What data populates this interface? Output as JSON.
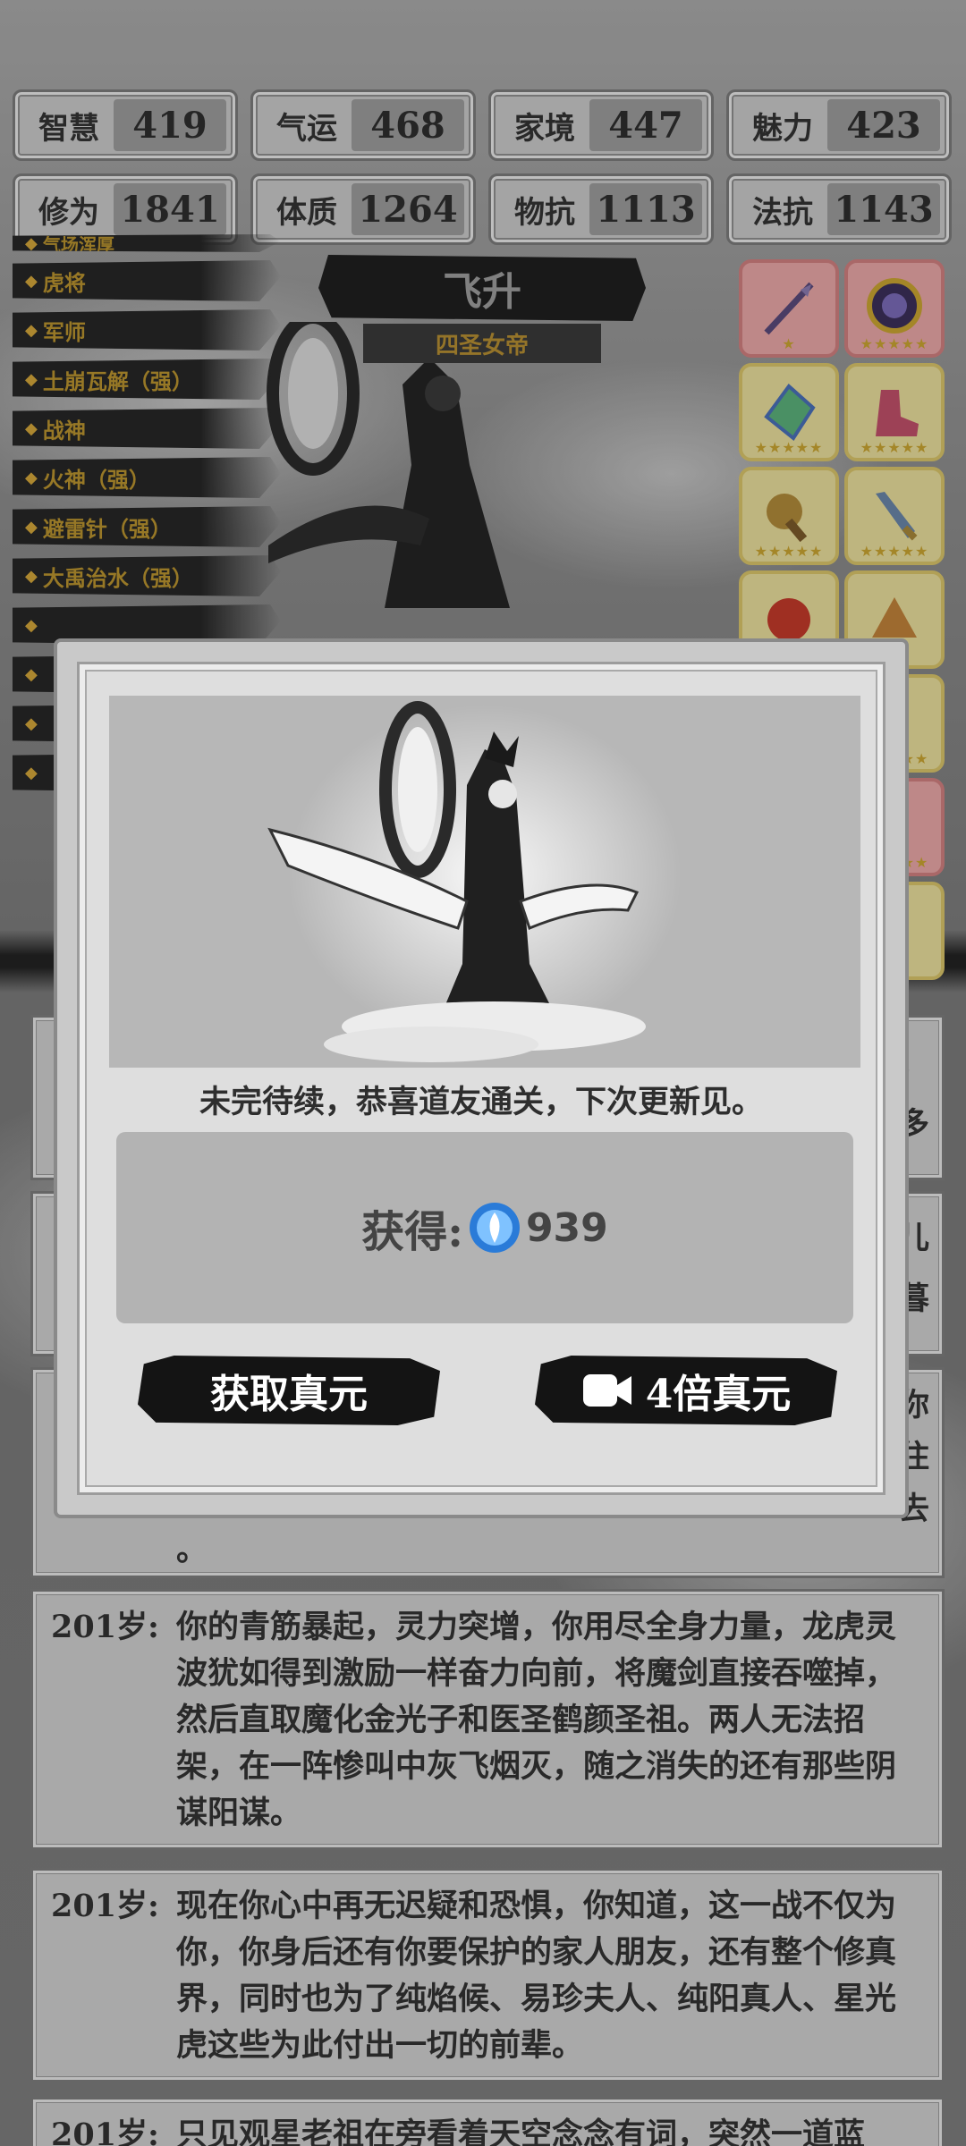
{
  "stats": [
    {
      "name": "智慧",
      "value": "419"
    },
    {
      "name": "气运",
      "value": "468"
    },
    {
      "name": "家境",
      "value": "447"
    },
    {
      "name": "魅力",
      "value": "423"
    },
    {
      "name": "修为",
      "value": "1841"
    },
    {
      "name": "体质",
      "value": "1264"
    },
    {
      "name": "物抗",
      "value": "1113"
    },
    {
      "name": "法抗",
      "value": "1143"
    }
  ],
  "skills": [
    {
      "label": "气场浑厚"
    },
    {
      "label": "虎将"
    },
    {
      "label": "军师"
    },
    {
      "label": "土崩瓦解（强）"
    },
    {
      "label": "战神"
    },
    {
      "label": "火神（强）"
    },
    {
      "label": "避雷针（强）"
    },
    {
      "label": "大禹治水（强）"
    }
  ],
  "character": {
    "stage": "飞升",
    "title": "四圣女帝"
  },
  "log": [
    {
      "age": "201岁:",
      "text": "你的青筋暴起，灵力突增，你用尽全身力量，龙虎灵波犹如得到激励一样奋力向前，将魔剑直接吞噬掉，然后直取魔化金光子和医圣鹤颜圣祖。两人无法招架，在一阵惨叫中灰飞烟灭，随之消失的还有那些阴谋阳谋。"
    },
    {
      "age": "201岁:",
      "text": "现在你心中再无迟疑和恐惧，你知道，这一战不仅为你，你身后还有你要保护的家人朋友，还有整个修真界，同时也为了纯焰候、易珍夫人、纯阳真人、星光虎这些为此付出一切的前辈。"
    },
    {
      "age": "201岁:",
      "text": "只见观星老祖在旁看着天空念念有词，突然一道蓝"
    }
  ],
  "log_partial": {
    "right_chars_1": "，",
    "right_chars_2": "多",
    "right_chars_3": "儿",
    "right_chars_4": "暮",
    "right_chars_5": "你",
    "right_chars_6": "住",
    "right_chars_7": "去",
    "end_char": "。"
  },
  "modal": {
    "message": "未完待续，恭喜道友通关，下次更新见。",
    "reward_label": "获得:",
    "reward_value": "939",
    "btn_claim": "获取真元",
    "btn_video": "4倍真元"
  },
  "colors": {
    "gold": "#b9932f",
    "panel": "#c9c9c9",
    "ink": "#141414"
  }
}
